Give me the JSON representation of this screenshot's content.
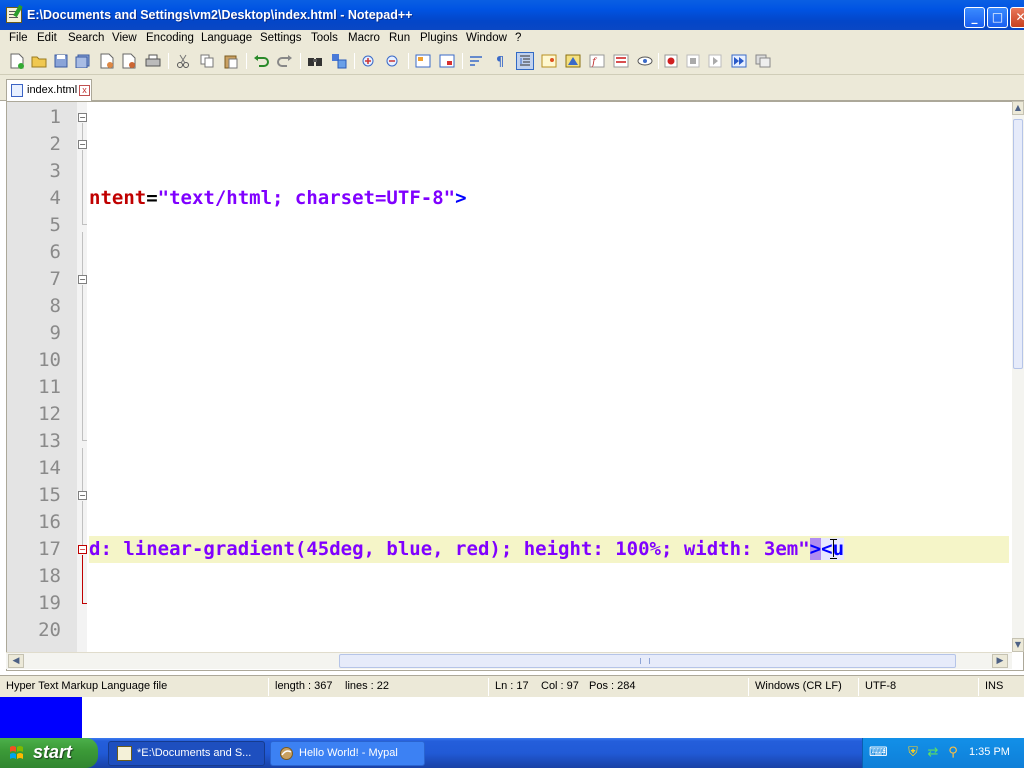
{
  "window": {
    "title": "E:\\Documents and Settings\\vm2\\Desktop\\index.html - Notepad++",
    "minimize": "_",
    "maximize": "□",
    "close": "✕"
  },
  "menu": [
    "File",
    "Edit",
    "Search",
    "View",
    "Encoding",
    "Language",
    "Settings",
    "Tools",
    "Macro",
    "Run",
    "Plugins",
    "Window",
    "?"
  ],
  "tab": {
    "label": "index.html",
    "close": "x"
  },
  "editor": {
    "line_numbers": [
      "1",
      "2",
      "3",
      "4",
      "5",
      "6",
      "7",
      "8",
      "9",
      "10",
      "11",
      "12",
      "13",
      "14",
      "15",
      "16",
      "17",
      "18",
      "19",
      "20"
    ],
    "fold_markers": {
      "open": "−"
    },
    "line4": {
      "attr": "ntent",
      "eq": "=",
      "value": "\"text/html; charset=UTF-8\"",
      "close": ">"
    },
    "line17": {
      "attr": "d",
      "value": ": linear-gradient(45deg, blue, red); height: 100%; width: 3em\"",
      "close": ">",
      "tag": "<u"
    }
  },
  "status": {
    "file_type": "Hyper Text Markup Language file",
    "length": "length : 367",
    "lines": "lines : 22",
    "ln": "Ln : 17",
    "col": "Col : 97",
    "pos": "Pos : 284",
    "eol": "Windows (CR LF)",
    "encoding": "UTF-8",
    "mode": "INS"
  },
  "taskbar": {
    "start": "start",
    "tasks": [
      {
        "label": "*E:\\Documents and S..."
      },
      {
        "label": "Hello World! - Mypal"
      }
    ],
    "clock": "1:35 PM"
  },
  "colors": {
    "attribute": "#c00000",
    "string": "#8000ff",
    "tag": "#0000ff",
    "current_line": "#f5f5c8",
    "brace_match": "#b08cf0"
  }
}
